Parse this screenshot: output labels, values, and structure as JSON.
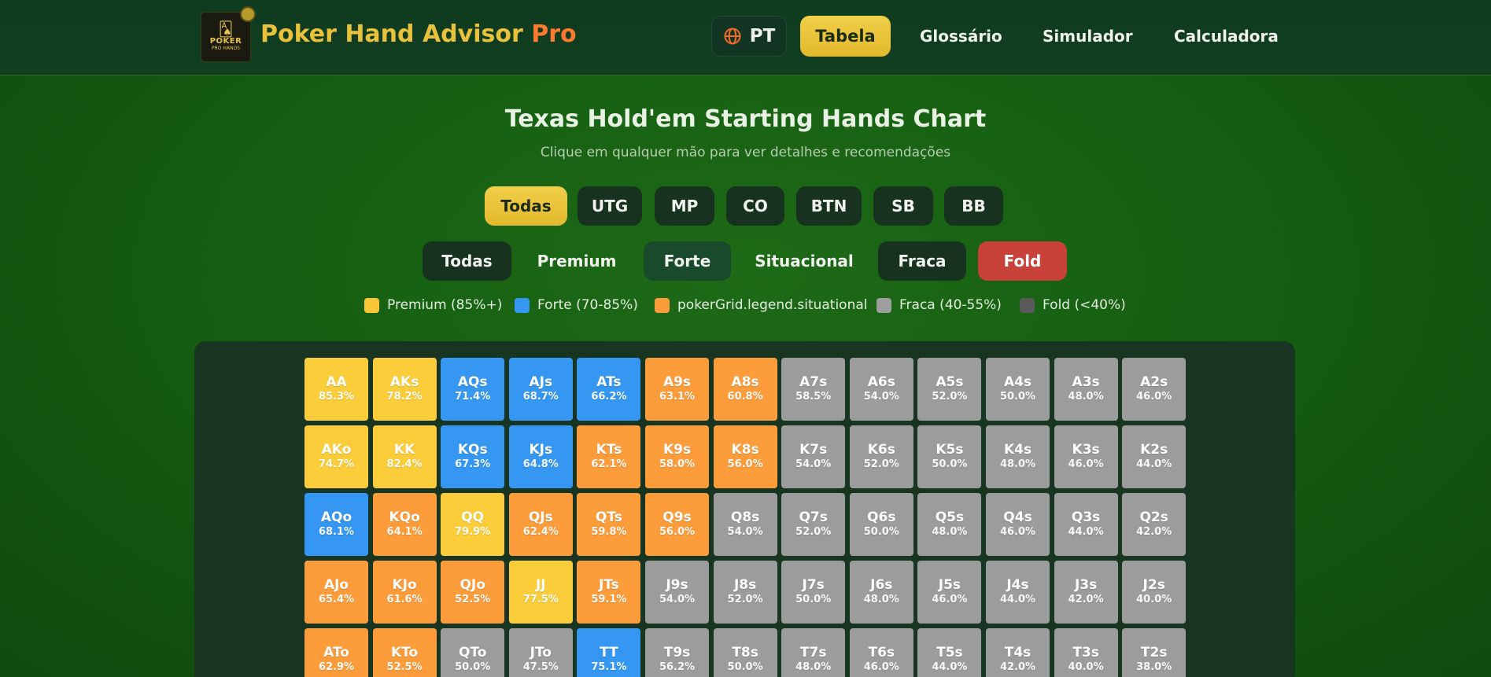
{
  "header": {
    "logo": {
      "cards_glyph": "🂡",
      "line1": "POKER",
      "line2": "PRO HANDS"
    },
    "brand_main": "Poker Hand Advisor",
    "brand_accent": "Pro",
    "lang_label": "PT",
    "nav": [
      {
        "label": "Tabela",
        "active": true
      },
      {
        "label": "Glossário"
      },
      {
        "label": "Simulador"
      },
      {
        "label": "Calculadora"
      }
    ]
  },
  "main": {
    "title": "Texas Hold'em Starting Hands Chart",
    "subtitle": "Clique em qualquer mão para ver detalhes e recomendações",
    "position_filters": [
      "Todas",
      "UTG",
      "MP",
      "CO",
      "BTN",
      "SB",
      "BB"
    ],
    "strength_filters": [
      "Todas",
      "Premium",
      "Forte",
      "Situacional",
      "Fraca",
      "Fold"
    ],
    "legend": [
      {
        "label": "Premium (85%+)",
        "color": "#f7c737"
      },
      {
        "label": "Forte (70-85%)",
        "color": "#3597f2"
      },
      {
        "label": "pokerGrid.legend.situational",
        "color": "#fb9c3a"
      },
      {
        "label": "Fraca (40-55%)",
        "color": "#9e9e9e"
      },
      {
        "label": "Fold (<40%)",
        "color": "#5a5a5a"
      }
    ]
  },
  "colors": {
    "premium": "#fccd3a",
    "strong": "#3597f2",
    "situational": "#fd9c3b",
    "weak": "#9c9c9c"
  },
  "grid": {
    "rows": [
      [
        [
          "AA",
          "85.3%",
          "premium"
        ],
        [
          "AKs",
          "78.2%",
          "premium"
        ],
        [
          "AQs",
          "71.4%",
          "strong"
        ],
        [
          "AJs",
          "68.7%",
          "strong"
        ],
        [
          "ATs",
          "66.2%",
          "strong"
        ],
        [
          "A9s",
          "63.1%",
          "situational"
        ],
        [
          "A8s",
          "60.8%",
          "situational"
        ],
        [
          "A7s",
          "58.5%",
          "weak"
        ],
        [
          "A6s",
          "54.0%",
          "weak"
        ],
        [
          "A5s",
          "52.0%",
          "weak"
        ],
        [
          "A4s",
          "50.0%",
          "weak"
        ],
        [
          "A3s",
          "48.0%",
          "weak"
        ],
        [
          "A2s",
          "46.0%",
          "weak"
        ]
      ],
      [
        [
          "AKo",
          "74.7%",
          "premium"
        ],
        [
          "KK",
          "82.4%",
          "premium"
        ],
        [
          "KQs",
          "67.3%",
          "strong"
        ],
        [
          "KJs",
          "64.8%",
          "strong"
        ],
        [
          "KTs",
          "62.1%",
          "situational"
        ],
        [
          "K9s",
          "58.0%",
          "situational"
        ],
        [
          "K8s",
          "56.0%",
          "situational"
        ],
        [
          "K7s",
          "54.0%",
          "weak"
        ],
        [
          "K6s",
          "52.0%",
          "weak"
        ],
        [
          "K5s",
          "50.0%",
          "weak"
        ],
        [
          "K4s",
          "48.0%",
          "weak"
        ],
        [
          "K3s",
          "46.0%",
          "weak"
        ],
        [
          "K2s",
          "44.0%",
          "weak"
        ]
      ],
      [
        [
          "AQo",
          "68.1%",
          "strong"
        ],
        [
          "KQo",
          "64.1%",
          "situational"
        ],
        [
          "QQ",
          "79.9%",
          "premium"
        ],
        [
          "QJs",
          "62.4%",
          "situational"
        ],
        [
          "QTs",
          "59.8%",
          "situational"
        ],
        [
          "Q9s",
          "56.0%",
          "situational"
        ],
        [
          "Q8s",
          "54.0%",
          "weak"
        ],
        [
          "Q7s",
          "52.0%",
          "weak"
        ],
        [
          "Q6s",
          "50.0%",
          "weak"
        ],
        [
          "Q5s",
          "48.0%",
          "weak"
        ],
        [
          "Q4s",
          "46.0%",
          "weak"
        ],
        [
          "Q3s",
          "44.0%",
          "weak"
        ],
        [
          "Q2s",
          "42.0%",
          "weak"
        ]
      ],
      [
        [
          "AJo",
          "65.4%",
          "situational"
        ],
        [
          "KJo",
          "61.6%",
          "situational"
        ],
        [
          "QJo",
          "52.5%",
          "situational"
        ],
        [
          "JJ",
          "77.5%",
          "premium"
        ],
        [
          "JTs",
          "59.1%",
          "situational"
        ],
        [
          "J9s",
          "54.0%",
          "weak"
        ],
        [
          "J8s",
          "52.0%",
          "weak"
        ],
        [
          "J7s",
          "50.0%",
          "weak"
        ],
        [
          "J6s",
          "48.0%",
          "weak"
        ],
        [
          "J5s",
          "46.0%",
          "weak"
        ],
        [
          "J4s",
          "44.0%",
          "weak"
        ],
        [
          "J3s",
          "42.0%",
          "weak"
        ],
        [
          "J2s",
          "40.0%",
          "weak"
        ]
      ],
      [
        [
          "ATo",
          "62.9%",
          "situational"
        ],
        [
          "KTo",
          "52.5%",
          "situational"
        ],
        [
          "QTo",
          "50.0%",
          "weak"
        ],
        [
          "JTo",
          "47.5%",
          "weak"
        ],
        [
          "TT",
          "75.1%",
          "strong"
        ],
        [
          "T9s",
          "56.2%",
          "weak"
        ],
        [
          "T8s",
          "50.0%",
          "weak"
        ],
        [
          "T7s",
          "48.0%",
          "weak"
        ],
        [
          "T6s",
          "46.0%",
          "weak"
        ],
        [
          "T5s",
          "44.0%",
          "weak"
        ],
        [
          "T4s",
          "42.0%",
          "weak"
        ],
        [
          "T3s",
          "40.0%",
          "weak"
        ],
        [
          "T2s",
          "38.0%",
          "weak"
        ]
      ]
    ]
  }
}
